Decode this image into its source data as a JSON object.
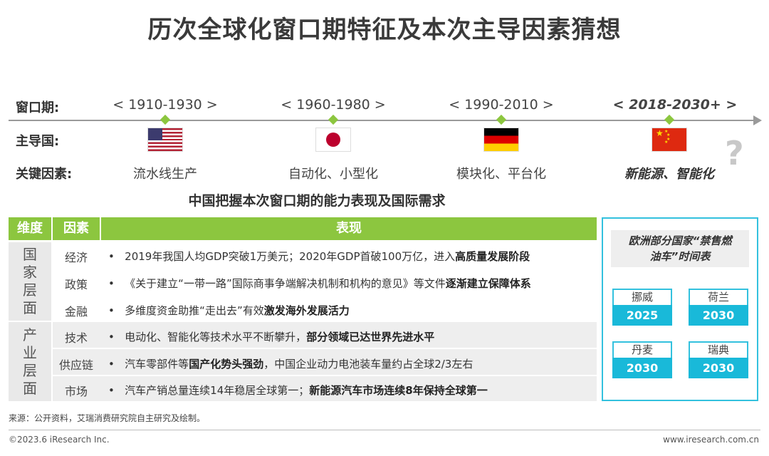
{
  "title": "历次全球化窗口期特征及本次主导因素猜想",
  "timeline": {
    "labels": {
      "window": "窗口期:",
      "leader": "主导国:",
      "factors": "关键因素:"
    },
    "periods": [
      {
        "window": "< 1910-1930 >",
        "country": "United States",
        "flag": "us-flag",
        "factor": "流水线生产"
      },
      {
        "window": "< 1960-1980 >",
        "country": "Japan",
        "flag": "jp-flag",
        "factor": "自动化、小型化"
      },
      {
        "window": "< 1990-2010 >",
        "country": "Germany",
        "flag": "de-flag",
        "factor": "模块化、平台化"
      },
      {
        "window": "< 2018-2030+ >",
        "country": "China",
        "flag": "cn-flag",
        "factor": "新能源、智能化"
      }
    ],
    "question_mark": "?",
    "accent_color": "#8cc63f"
  },
  "subtitle": "中国把握本次窗口期的能力表现及国际需求",
  "table": {
    "headers": [
      "维度",
      "因素",
      "表现"
    ],
    "groups": [
      {
        "dimension": "国家层面",
        "rows": [
          {
            "factor": "经济",
            "desc_plain": "2019年我国人均GDP突破1万美元；2020年GDP首破100万亿，进入",
            "desc_bold": "高质量发展阶段",
            "desc_tail": ""
          },
          {
            "factor": "政策",
            "desc_plain": "《关于建立“一带一路”国际商事争端解决机制和机构的意见》等文件",
            "desc_bold": "逐渐建立保障体系",
            "desc_tail": ""
          },
          {
            "factor": "金融",
            "desc_plain": "多维度资金助推“走出去”有效",
            "desc_bold": "激发海外发展活力",
            "desc_tail": ""
          }
        ]
      },
      {
        "dimension": "产业层面",
        "rows": [
          {
            "factor": "技术",
            "desc_plain": "电动化、智能化等技术水平不断攀升，",
            "desc_bold": "部分领域已达世界先进水平",
            "desc_tail": ""
          },
          {
            "factor": "供应链",
            "desc_plain": "汽车零部件等",
            "desc_bold": "国产化势头强劲",
            "desc_tail": "，中国企业动力电池装车量约占全球2/3左右"
          },
          {
            "factor": "市场",
            "desc_plain": "汽车产销总量连续14年稳居全球第一；",
            "desc_bold": "新能源汽车市场连续8年保持全球第一",
            "desc_tail": ""
          }
        ]
      }
    ],
    "bullet": "•"
  },
  "ban_panel": {
    "title_line1": "欧洲部分国家“禁售燃",
    "title_line2": "油车”时间表",
    "countries": [
      {
        "name": "挪威",
        "year": "2025"
      },
      {
        "name": "荷兰",
        "year": "2030"
      },
      {
        "name": "丹麦",
        "year": "2030"
      },
      {
        "name": "瑞典",
        "year": "2030"
      }
    ],
    "accent_color": "#19b9d9"
  },
  "source": "来源：公开资料，艾瑞消费研究院自主研究及绘制。",
  "footer": {
    "copyright": "©2023.6 iResearch Inc.",
    "website": "www.iresearch.com.cn"
  }
}
